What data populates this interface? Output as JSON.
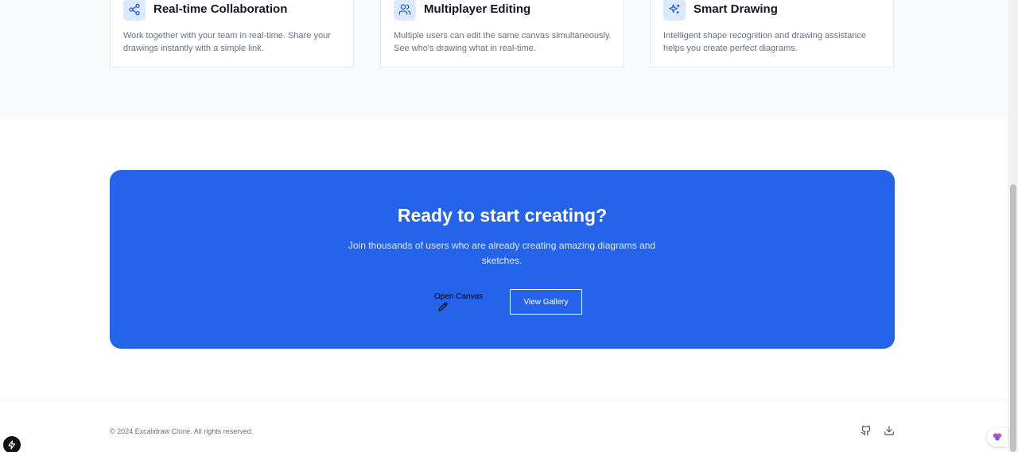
{
  "features": [
    {
      "icon": "share-icon",
      "title": "Real-time Collaboration",
      "description": "Work together with your team in real-time. Share your drawings instantly with a simple link."
    },
    {
      "icon": "users-icon",
      "title": "Multiplayer Editing",
      "description": "Multiple users can edit the same canvas simultaneously. See who's drawing what in real-time."
    },
    {
      "icon": "sparkles-icon",
      "title": "Smart Drawing",
      "description": "Intelligent shape recognition and drawing assistance helps you create perfect diagrams."
    }
  ],
  "cta": {
    "heading": "Ready to start creating?",
    "subtext": "Join thousands of users who are already creating amazing diagrams and sketches.",
    "primary_label": "Open Canvas",
    "secondary_label": "View Gallery"
  },
  "footer": {
    "copyright": "© 2024 Excalidraw Clone. All rights reserved.",
    "icons": [
      "github-icon",
      "download-icon"
    ]
  },
  "colors": {
    "accent": "#2563eb",
    "icon_bg": "#dbeafe",
    "section_bg": "#f9fafb"
  }
}
